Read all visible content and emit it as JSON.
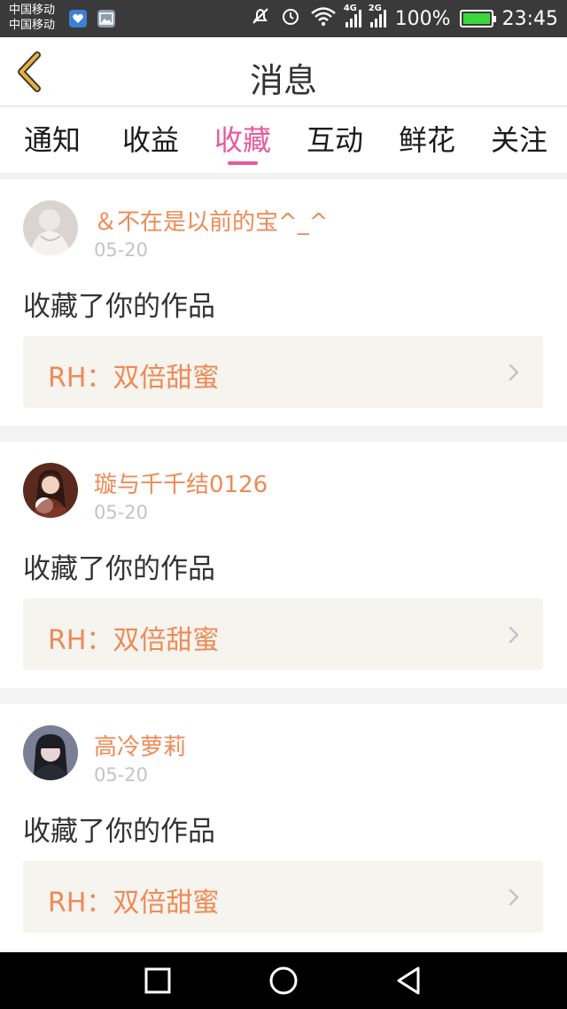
{
  "status_bar": {
    "carrier_1": "中国移动",
    "carrier_2": "中国移动",
    "net_1": "4G",
    "net_2": "2G",
    "battery": "100%",
    "time": "23:45"
  },
  "header": {
    "title": "消息",
    "back_icon": "chevron-left-icon"
  },
  "tabs": [
    {
      "label": "通知",
      "active": false
    },
    {
      "label": "收益",
      "active": false
    },
    {
      "label": "收藏",
      "active": true
    },
    {
      "label": "互动",
      "active": false
    },
    {
      "label": "鲜花",
      "active": false
    },
    {
      "label": "关注",
      "active": false
    }
  ],
  "messages": [
    {
      "username": "＆不在是以前的宝^_^",
      "date": "05-20",
      "action": "收藏了你的作品",
      "work": "RH：双倍甜蜜"
    },
    {
      "username": "璇与千千结0126",
      "date": "05-20",
      "action": "收藏了你的作品",
      "work": "RH：双倍甜蜜"
    },
    {
      "username": "高冷萝莉",
      "date": "05-20",
      "action": "收藏了你的作品",
      "work": "RH：双倍甜蜜"
    }
  ],
  "colors": {
    "accent": "#e75a9c",
    "username": "#ef8a55",
    "back_icon": "#e9b23b"
  }
}
